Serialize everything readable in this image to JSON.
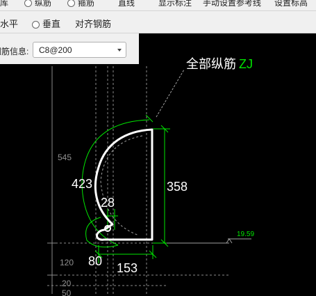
{
  "toolbar_top": {
    "item1": "纵筋",
    "item2": "箍筋",
    "item3": "直线",
    "item4": "显示标注",
    "item5": "手动设置参考线",
    "item6": "设置标高"
  },
  "toolbar_row2": {
    "horizontal": "水平",
    "vertical": "垂直",
    "align_rebar": "对齐钢筋"
  },
  "info": {
    "label": "钢筋信息:",
    "select_value": "C8@200"
  },
  "drawing": {
    "callout_label": "全部纵筋",
    "callout_code": "ZJ",
    "dim_358": "358",
    "dim_423": "423",
    "dim_28": "28",
    "dim_80": "80",
    "dim_153": "153",
    "elev_value": "19.59",
    "side_545": "545",
    "side_120": "120",
    "side_20": "20",
    "side_50": "50"
  },
  "colors": {
    "canvas_bg": "#000000",
    "dimension": "#00ff00",
    "rebar": "#ffffff",
    "text": "#ffffff",
    "guide": "#808080"
  }
}
